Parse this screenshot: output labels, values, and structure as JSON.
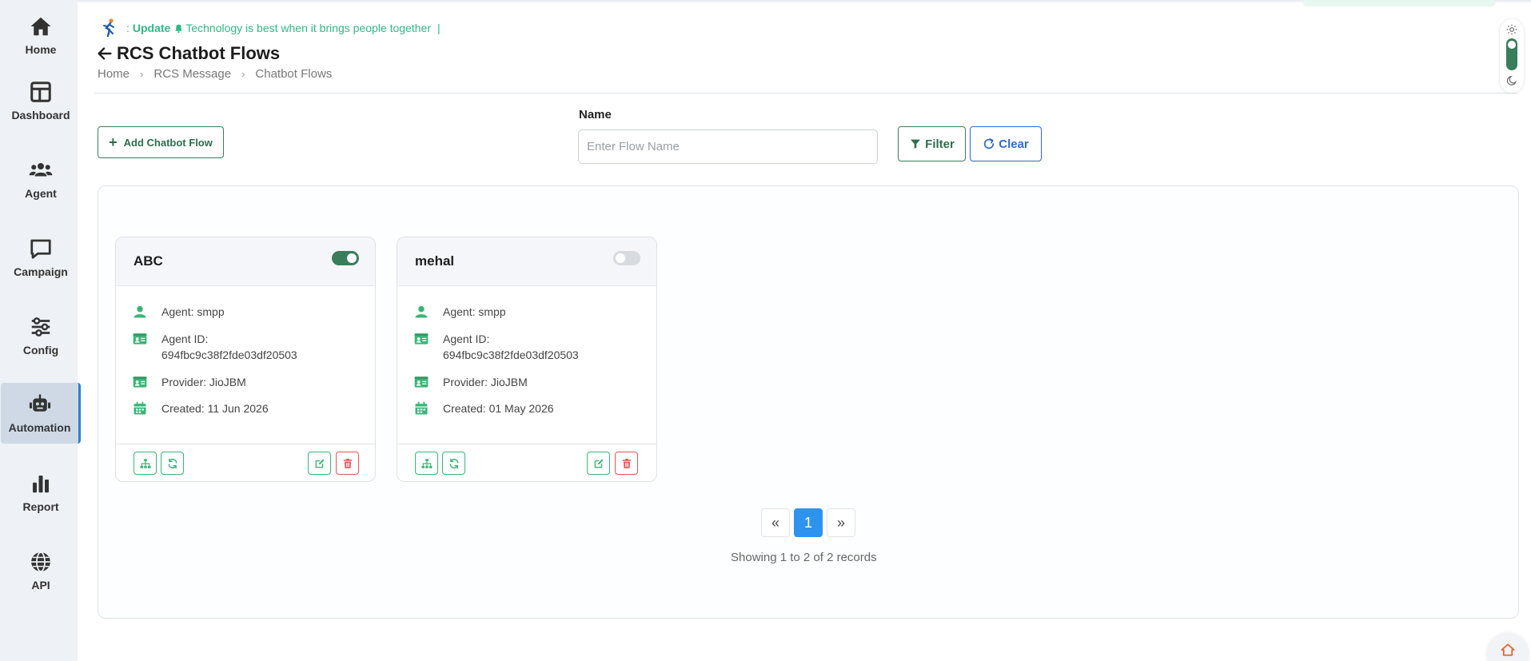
{
  "sidebar": {
    "items": [
      {
        "label": "Home",
        "icon": "home-icon"
      },
      {
        "label": "Dashboard",
        "icon": "dashboard-icon"
      },
      {
        "label": "Agent",
        "icon": "users-icon"
      },
      {
        "label": "Campaign",
        "icon": "chat-icon"
      },
      {
        "label": "Config",
        "icon": "sliders-icon"
      },
      {
        "label": "Automation",
        "icon": "robot-icon",
        "active": true
      },
      {
        "label": "Report",
        "icon": "bar-chart-icon"
      },
      {
        "label": "API",
        "icon": "globe-icon"
      }
    ]
  },
  "marquee": {
    "prefix": ":",
    "update_label": "Update",
    "message": "Technology is best when it brings people together",
    "cursor": "|"
  },
  "header": {
    "title": "RCS Chatbot Flows",
    "breadcrumb": [
      "Home",
      "RCS Message",
      "Chatbot Flows"
    ],
    "breadcrumb_sep": "›"
  },
  "toolbar": {
    "add_label": "Add Chatbot Flow",
    "name_label": "Name",
    "name_placeholder": "Enter Flow Name",
    "name_value": "",
    "filter_label": "Filter",
    "clear_label": "Clear"
  },
  "cards": [
    {
      "title": "ABC",
      "enabled": true,
      "agent": "Agent: smpp",
      "agent_id_label": "Agent ID:",
      "agent_id": "694fbc9c38f2fde03df20503",
      "provider": "Provider: JioJBM",
      "created": "Created: 11 Jun 2026"
    },
    {
      "title": "mehal",
      "enabled": false,
      "agent": "Agent: smpp",
      "agent_id_label": "Agent ID:",
      "agent_id": "694fbc9c38f2fde03df20503",
      "provider": "Provider: JioJBM",
      "created": "Created: 01 May 2026"
    }
  ],
  "pagination": {
    "prev": "«",
    "current": "1",
    "next": "»",
    "summary": "Showing 1 to 2 of 2 records"
  },
  "colors": {
    "accent_green": "#3a7d5b",
    "icon_green": "#3ab577",
    "danger": "#e55353",
    "primary_blue": "#2e93ef",
    "marquee_green": "#2fb985"
  }
}
